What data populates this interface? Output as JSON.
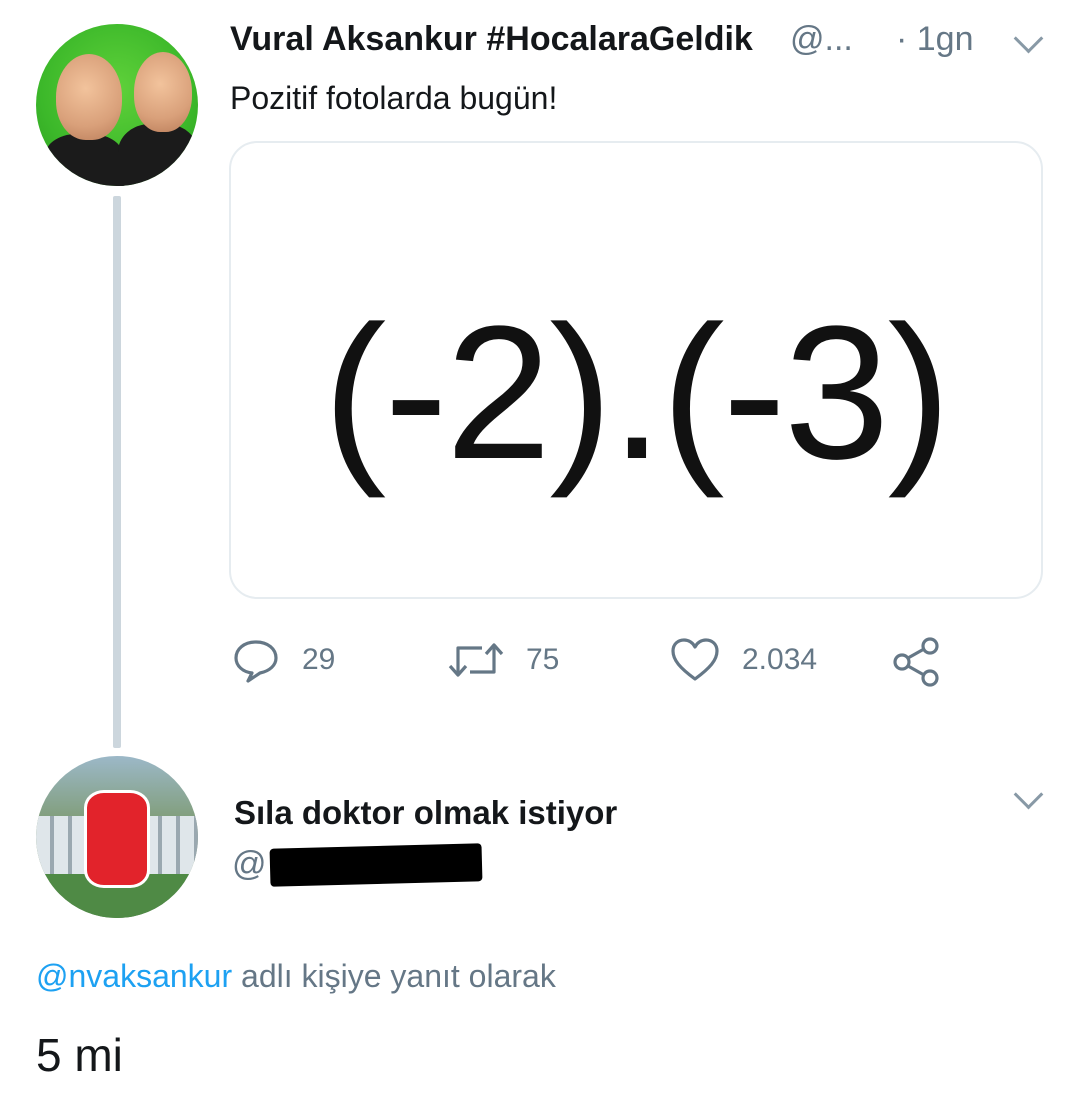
{
  "tweet": {
    "author_name": "Vural Aksankur #HocalaraGeldik",
    "handle_truncated": "@...",
    "time": "· 1gn",
    "text": "Pozitif fotolarda bugün!",
    "media_text": "(-2).(-3)",
    "actions": {
      "reply_count": "29",
      "retweet_count": "75",
      "like_count": "2.034"
    }
  },
  "reply": {
    "author_name": "Sıla doktor olmak istiyor",
    "handle_visible": "@",
    "replying_to_mention": "@nvaksankur",
    "replying_to_suffix": " adlı kişiye yanıt olarak",
    "text": "5 mi"
  },
  "colors": {
    "link": "#1da1f2",
    "muted": "#657786",
    "thread_line": "#ccd6dd",
    "border": "#e6ecf0"
  },
  "icons": [
    "chevron-down-icon",
    "reply-icon",
    "retweet-icon",
    "like-icon",
    "share-icon"
  ]
}
